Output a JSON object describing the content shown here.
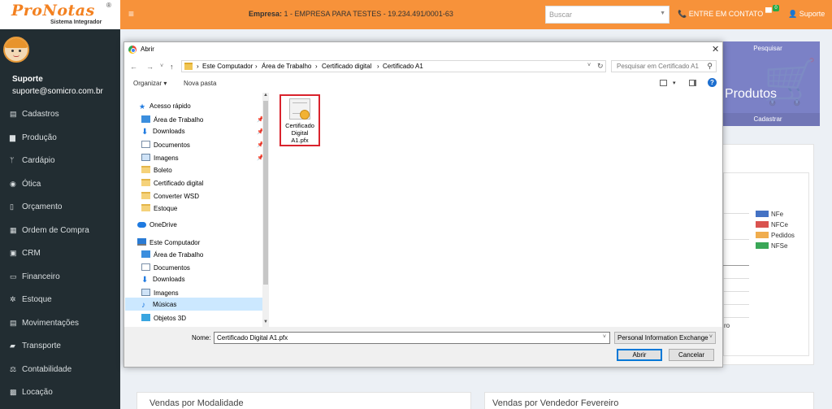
{
  "app": {
    "logo_text": "ProNotas",
    "logo_reg": "®",
    "logo_subtitle": "Sistema Integrador",
    "hamburger": "≡",
    "empresa_label": "Empresa:",
    "empresa_value": "1 - EMPRESA PARA TESTES - 19.234.491/0001-63",
    "search_placeholder": "Buscar",
    "contact_label": "ENTRE EM CONTATO",
    "notification_count": "0",
    "user_label": "Suporte"
  },
  "sidebar": {
    "user_name": "Suporte",
    "user_email": "suporte@somicro.com.br",
    "items": [
      {
        "label": "Cadastros",
        "icon": "▤"
      },
      {
        "label": "Produção",
        "icon": "▆"
      },
      {
        "label": "Cardápio",
        "icon": "ᛘ"
      },
      {
        "label": "Ótica",
        "icon": "◉"
      },
      {
        "label": "Orçamento",
        "icon": "▯"
      },
      {
        "label": "Ordem de Compra",
        "icon": "▦"
      },
      {
        "label": "CRM",
        "icon": "▣"
      },
      {
        "label": "Financeiro",
        "icon": "▭"
      },
      {
        "label": "Estoque",
        "icon": "✲"
      },
      {
        "label": "Movimentações",
        "icon": "▤"
      },
      {
        "label": "Transporte",
        "icon": "▰"
      },
      {
        "label": "Contabilidade",
        "icon": "⚖"
      },
      {
        "label": "Locação",
        "icon": "▩"
      }
    ]
  },
  "dashboard": {
    "produtos_top": "Pesquisar",
    "produtos_title": "Produtos",
    "produtos_bottom": "Cadastrar",
    "legend": [
      {
        "label": "NFe",
        "color": "#4472c4"
      },
      {
        "label": "NFCe",
        "color": "#d9534f"
      },
      {
        "label": "Pedidos",
        "color": "#f0ad4e"
      },
      {
        "label": "NFSe",
        "color": "#3aa757"
      }
    ],
    "cut_text": "ro",
    "bottom_left_title": "Vendas por Modalidade",
    "bottom_right_title": "Vendas por Vendedor Fevereiro"
  },
  "dialog": {
    "title": "Abrir",
    "close": "✕",
    "nav_back": "←",
    "nav_forward": "→",
    "nav_recent": "˅",
    "nav_up": "↑",
    "path": [
      "Este Computador",
      "Área de Trabalho",
      "Certificado digital",
      "Certificado A1"
    ],
    "path_sep": "›",
    "search_placeholder": "Pesquisar em Certificado A1",
    "toolbar": {
      "organize": "Organizar ▾",
      "new_folder": "Nova pasta",
      "help": "?"
    },
    "nav_tree": [
      {
        "label": "Acesso rápido",
        "icon": "star",
        "pinned": false
      },
      {
        "label": "Área de Trabalho",
        "icon": "desk",
        "pinned": true
      },
      {
        "label": "Downloads",
        "icon": "down",
        "pinned": true
      },
      {
        "label": "Documentos",
        "icon": "doc",
        "pinned": true
      },
      {
        "label": "Imagens",
        "icon": "img",
        "pinned": true
      },
      {
        "label": "Boleto",
        "icon": "folder",
        "pinned": false
      },
      {
        "label": "Certificado digital",
        "icon": "folder",
        "pinned": false
      },
      {
        "label": "Converter WSD",
        "icon": "folder",
        "pinned": false
      },
      {
        "label": "Estoque",
        "icon": "folder",
        "pinned": false
      },
      {
        "label": "OneDrive",
        "icon": "cloud",
        "pinned": false
      },
      {
        "label": "Este Computador",
        "icon": "pc",
        "pinned": false
      },
      {
        "label": "Área de Trabalho",
        "icon": "desk",
        "pinned": false,
        "selected": true
      },
      {
        "label": "Documentos",
        "icon": "doc",
        "pinned": false
      },
      {
        "label": "Downloads",
        "icon": "down",
        "pinned": false
      },
      {
        "label": "Imagens",
        "icon": "img",
        "pinned": false
      },
      {
        "label": "Músicas",
        "icon": "music",
        "pinned": false
      },
      {
        "label": "Objetos 3D",
        "icon": "d3",
        "pinned": false
      }
    ],
    "files": [
      {
        "name_line1": "Certificado",
        "name_line2": "Digital",
        "name_line3": "A1.pfx"
      }
    ],
    "footer": {
      "name_label": "Nome:",
      "name_value": "Certificado Digital A1.pfx",
      "file_type": "Personal Information Exchange",
      "open_button": "Abrir",
      "cancel_button": "Cancelar"
    }
  }
}
